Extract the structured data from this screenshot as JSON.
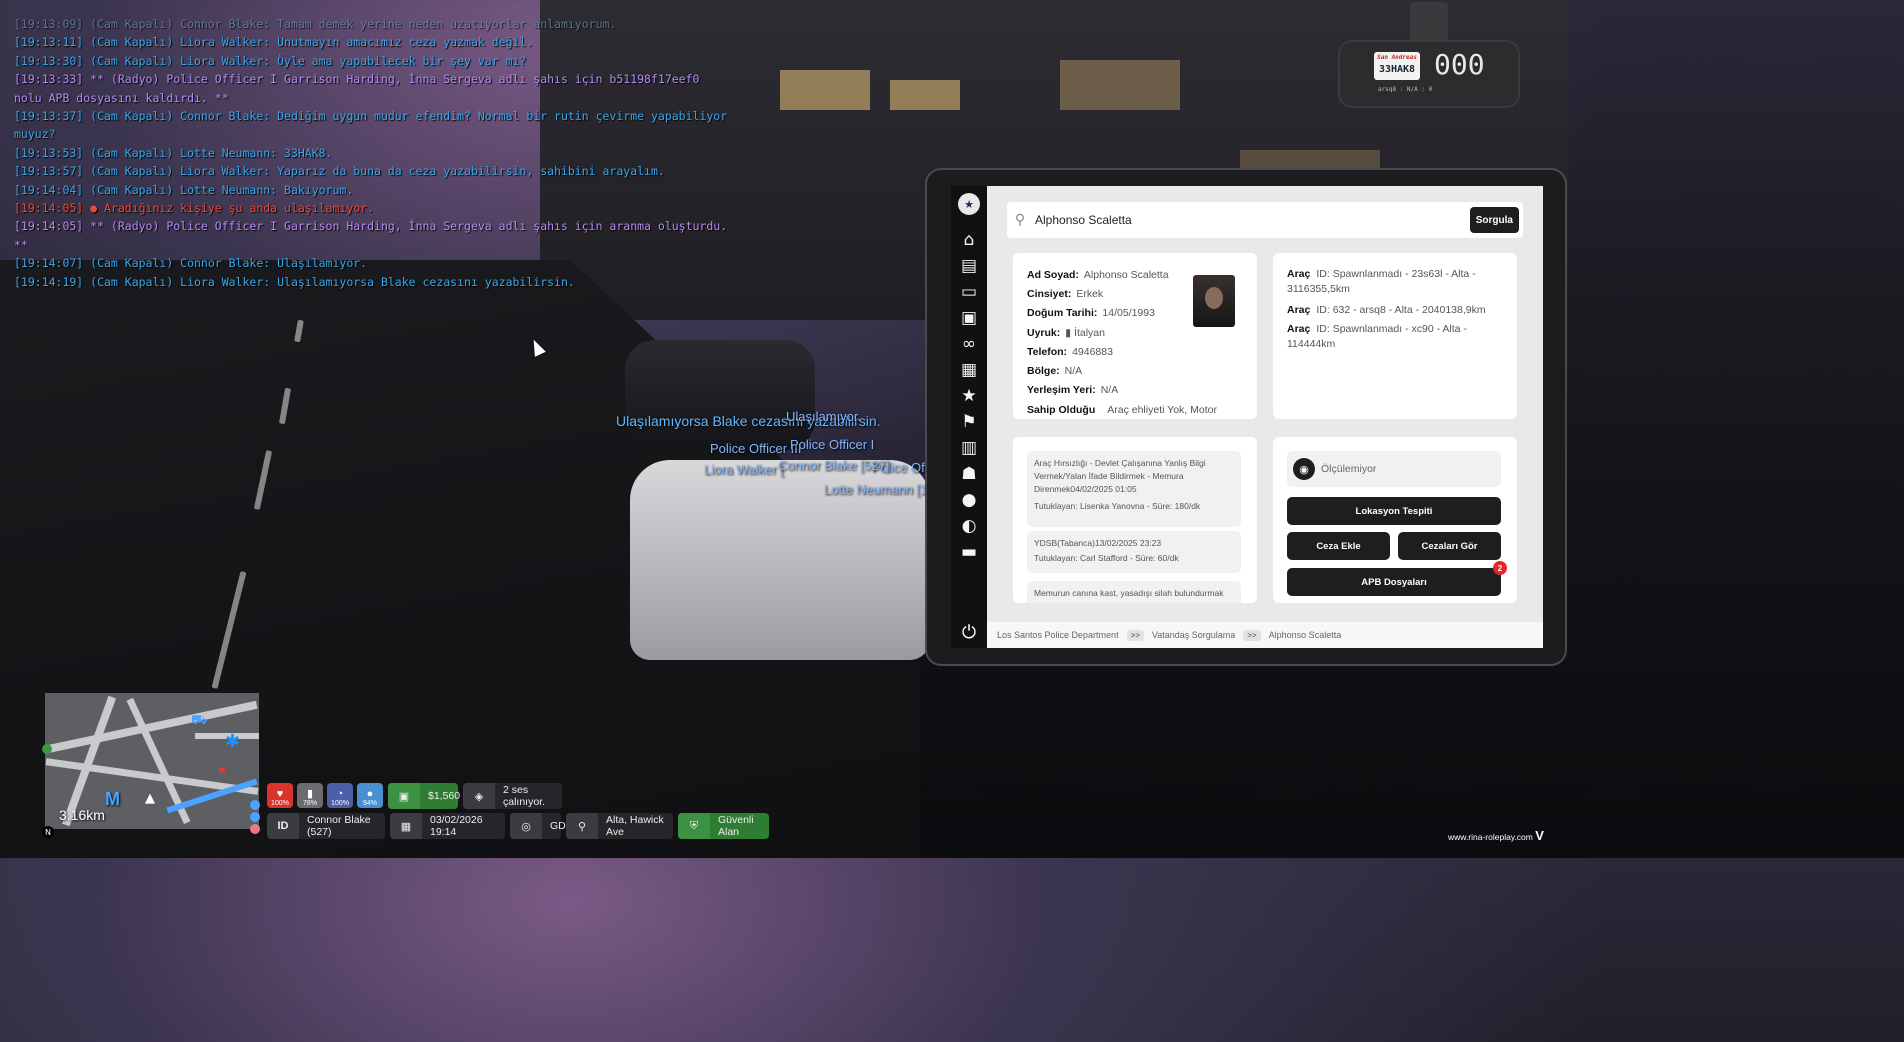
{
  "chat": [
    {
      "text": "[19:13:09] (Cam Kapalı) Connor Blake: Tamam demek yerine neden uzatıyorlar anlamıyorum.",
      "color": "faded"
    },
    {
      "text": "[19:13:11] (Cam Kapalı) Liora Walker: Unutmayın amacımız ceza yazmak değil.",
      "color": "blue"
    },
    {
      "text": "[19:13:30] (Cam Kapalı) Liora Walker: Öyle ama yapabilecek bir şey var mı?",
      "color": "blue"
    },
    {
      "text": "[19:13:33] ** (Radyo) Police Officer I Garrison Harding, İnna Sergeva adlı şahıs için b51198f17eef0 nolu APB dosyasını kaldırdı. **",
      "color": "purple"
    },
    {
      "text": "[19:13:37] (Cam Kapalı) Connor Blake: Dediğim uygun mudur efendim? Normal bir rutin çevirme yapabiliyor muyuz?",
      "color": "blue"
    },
    {
      "text": "[19:13:53] (Cam Kapalı) Lotte Neumann: 33HAK8.",
      "color": "blue"
    },
    {
      "text": "[19:13:57] (Cam Kapalı) Liora Walker: Yaparız da buna da ceza yazabilirsin, sahibini arayalım.",
      "color": "blue"
    },
    {
      "text": "[19:14:04] (Cam Kapalı) Lotte Neumann: Bakıyorum.",
      "color": "blue"
    },
    {
      "text": "[19:14:05] ● Aradığınız kişiye şu anda ulaşılamıyor.",
      "color": "red"
    },
    {
      "text": "[19:14:05] ** (Radyo) Police Officer I Garrison Harding, İnna Sergeva adlı şahıs için aranma oluşturdu. **",
      "color": "purple"
    },
    {
      "text": "[19:14:07] (Cam Kapalı) Connor Blake: Ulaşılamıyor.",
      "color": "blue"
    },
    {
      "text": "[19:14:19] (Cam Kapalı) Liora Walker: Ulaşılamıyorsa Blake cezasını yazabilirsin.",
      "color": "blue"
    }
  ],
  "overhead": {
    "speech1": "Ulaşılamıyorsa Blake cezasını yazabilirsin.",
    "speech2": "Ulaşılamıyor.",
    "rank1": "Police Officer III",
    "rank2": "Police Officer I",
    "rank3": "Police Officer I",
    "name1": "Liora Walker [",
    "name2": "Connor Blake [527]",
    "name3": "Lotte Neumann [123"
  },
  "dashcam": {
    "plate": "33HAK8",
    "plate_top": "San Andreas",
    "speed": "000",
    "sub": "arsq8 : N/A : 0"
  },
  "mdt": {
    "search_value": "Alphonso Scaletta",
    "search_button": "Sorgula",
    "sidebar_icons": [
      "home-icon",
      "document-icon",
      "folder-icon",
      "lock-icon",
      "binoculars-icon",
      "briefcase-icon",
      "star-icon",
      "flag-icon",
      "clipboard-icon",
      "group-icon",
      "user-icon",
      "speedometer-icon",
      "archive-icon"
    ],
    "person": {
      "name_k": "Ad Soyad:",
      "name_v": "Alphonso Scaletta",
      "gender_k": "Cinsiyet:",
      "gender_v": "Erkek",
      "dob_k": "Doğum Tarihi:",
      "dob_v": "14/05/1993",
      "nat_k": "Uyruk:",
      "nat_v": "İtalyan",
      "phone_k": "Telefon:",
      "phone_v": "4946883",
      "region_k": "Bölge:",
      "region_v": "N/A",
      "res_k": "Yerleşim Yeri:",
      "res_v": "N/A",
      "lic_k": "Sahip Olduğu",
      "lic_v": "Araç ehliyeti Yok, Motor"
    },
    "vehicles": [
      {
        "k": "Araç",
        "v": "ID: Spawnlanmadı - 23s63l - Alta - 3116355,5km"
      },
      {
        "k": "Araç",
        "v": "ID: 632 - arsq8 - Alta - 2040138,9km"
      },
      {
        "k": "Araç",
        "v": "ID: Spawnlanmadı - xc90 - Alta - 114444km"
      }
    ],
    "crimes": [
      {
        "title": "Araç Hırsızlığı - Devlet Çalışanına Yanlış Bilgi Vermek/Yalan İfade Bildirmek - Memura Direnmek",
        "date": "04/02/2025 01:05",
        "detail": "Tutuklayan: Lisenka Yanovna - Süre: 180/dk"
      },
      {
        "title": "YDSB(Tabanca)",
        "date": "13/02/2025 23:23",
        "detail": "Tutuklayan: Carl Stafford - Süre: 60/dk"
      },
      {
        "title": "Memurun canına kast, yasadışı silah bulundurmak",
        "date": "",
        "detail": ""
      }
    ],
    "location_label": "Ölçülemiyor",
    "btn_locate": "Lokasyon Tespiti",
    "btn_fine": "Ceza Ekle",
    "btn_view_fines": "Cezaları Gör",
    "btn_apb": "APB Dosyaları",
    "apb_count": "2",
    "crumbs": [
      "Los Santos Police Department",
      "Vatandaş Sorgulama",
      "Alphonso Scaletta"
    ],
    "crumb_sep": ">>"
  },
  "minimap": {
    "distance": "3.16km",
    "marker": "M",
    "north": "N"
  },
  "hud": {
    "health": "100%",
    "armor": "78%",
    "hunger": "100%",
    "thirst": "94%",
    "cash": "$1,560",
    "voice": "2 ses çalınıyor.",
    "id_label": "ID",
    "player": "Connor Blake (527)",
    "datetime": "03/02/2026 19:14",
    "direction": "GD",
    "location": "Alta, Hawick Ave",
    "zone": "Güvenli Alan"
  },
  "watermark": "www.rina-roleplay.com",
  "colors": {
    "chat_blue": "#3aa6e8",
    "chat_red": "#e84a3a",
    "chat_purple": "#b48cf0",
    "health": "#d9342b",
    "armor": "#6b6b70",
    "hunger": "#4a5fa8",
    "thirst": "#4a8fd0",
    "money": "#2e7d32"
  }
}
